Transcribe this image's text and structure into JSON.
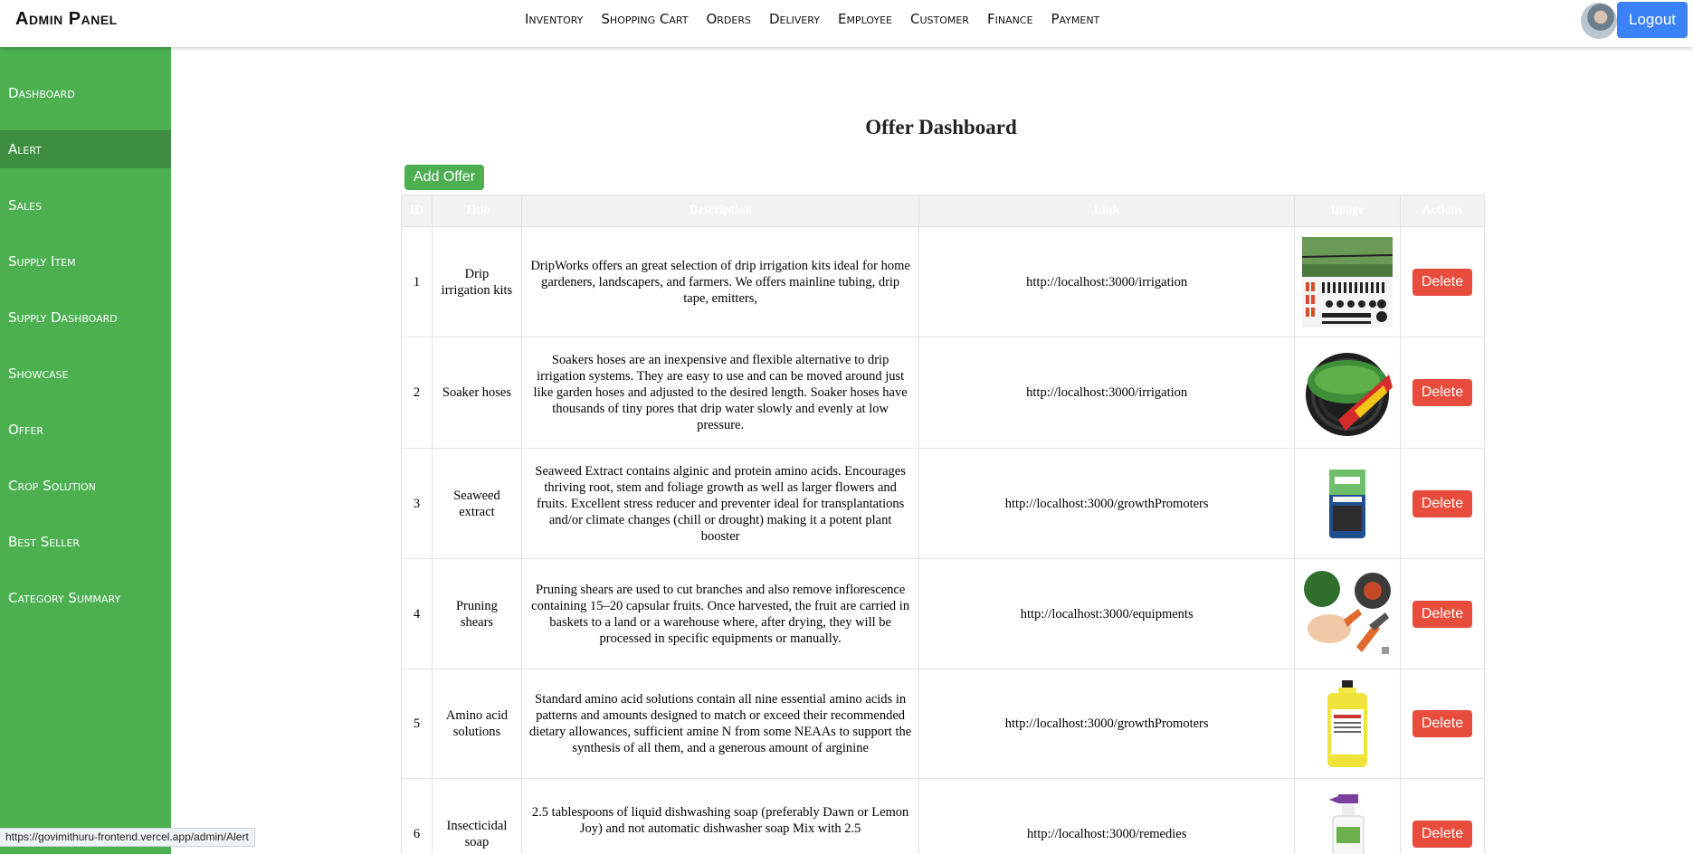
{
  "header": {
    "brand": "Admin Panel",
    "nav": [
      "Inventory",
      "Shopping Cart",
      "Orders",
      "Delivery",
      "Employee",
      "Customer",
      "Finance",
      "Payment"
    ],
    "logout_label": "Logout"
  },
  "sidebar": {
    "items": [
      {
        "label": "Dashboard"
      },
      {
        "label": "Alert",
        "active": true
      },
      {
        "label": "Sales"
      },
      {
        "label": "Supply Item"
      },
      {
        "label": "Supply Dashboard"
      },
      {
        "label": "Showcase"
      },
      {
        "label": "Offer"
      },
      {
        "label": "Crop Solution"
      },
      {
        "label": "Best Seller"
      },
      {
        "label": "Category Summary"
      }
    ],
    "color": "#4caf50"
  },
  "main": {
    "title": "Offer Dashboard",
    "add_label": "Add Offer",
    "table": {
      "headers": [
        "ID",
        "Title",
        "Description",
        "Link",
        "Image",
        "Actions"
      ],
      "rows": [
        {
          "id": "1",
          "title": "Drip irrigation kits",
          "description": "DripWorks offers an great selection of drip irrigation kits ideal for home gardeners, landscapers, and farmers. We offers mainline tubing, drip tape, emitters,",
          "link": "http://localhost:3000/irrigation",
          "image": "drip-kit-image",
          "action": "Delete"
        },
        {
          "id": "2",
          "title": "Soaker hoses",
          "description": "Soakers hoses are an inexpensive and flexible alternative to drip irrigation systems. They are easy to use and can be moved around just like garden hoses and adjusted to the desired length. Soaker hoses have thousands of tiny pores that drip water slowly and evenly at low pressure.",
          "link": "http://localhost:3000/irrigation",
          "image": "soaker-hose-image",
          "action": "Delete"
        },
        {
          "id": "3",
          "title": "Seaweed extract",
          "description": "Seaweed Extract contains alginic and protein amino acids. Encourages thriving root, stem and foliage growth as well as larger flowers and fruits. Excellent stress reducer and preventer ideal for transplantations and/or climate changes (chill or drought) making it a potent plant booster",
          "link": "http://localhost:3000/growthPromoters",
          "image": "seaweed-bag-image",
          "action": "Delete"
        },
        {
          "id": "4",
          "title": "Pruning shears",
          "description": "Pruning shears are used to cut branches and also remove inflorescence containing 15–20 capsular fruits. Once harvested, the fruit are carried in baskets to a land or a warehouse where, after drying, they will be processed in specific equipments or manually.",
          "link": "http://localhost:3000/equipments",
          "image": "shears-image",
          "action": "Delete"
        },
        {
          "id": "5",
          "title": "Amino acid solutions",
          "description": "Standard amino acid solutions contain all nine essential amino acids in patterns and amounts designed to match or exceed their recommended dietary allowances, sufficient amine N from some NEAAs to support the synthesis of all them, and a generous amount of arginine",
          "link": "http://localhost:3000/growthPromoters",
          "image": "amino-bottle-image",
          "action": "Delete"
        },
        {
          "id": "6",
          "title": "Insecticidal soap",
          "description": "2.5 tablespoons of liquid dishwashing soap (preferably Dawn or Lemon Joy) and not automatic dishwasher soap Mix with 2.5",
          "link": "http://localhost:3000/remedies",
          "image": "spray-bottle-image",
          "action": "Delete"
        }
      ]
    }
  },
  "status": {
    "url": "https://govimithuru-frontend.vercel.app/admin/Alert"
  },
  "colors": {
    "accent_green": "#4caf50",
    "active_green": "#3e8e41",
    "logout_blue": "#3b82f6",
    "delete_red": "#e74c3c"
  }
}
